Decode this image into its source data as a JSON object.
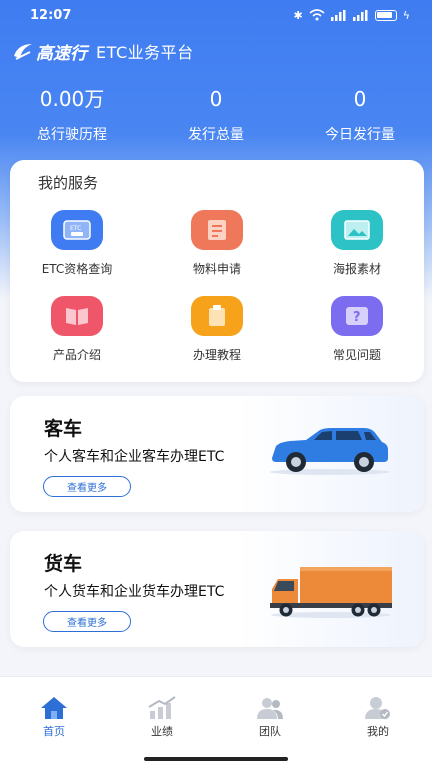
{
  "status_bar": {
    "time": "12:07"
  },
  "header": {
    "logo_text": "高速行",
    "title": "ETC业务平台"
  },
  "stats": [
    {
      "value": "0.00万",
      "label": "总行驶历程"
    },
    {
      "value": "0",
      "label": "发行总量"
    },
    {
      "value": "0",
      "label": "今日发行量"
    }
  ],
  "services": {
    "title": "我的服务",
    "items": [
      {
        "label": "ETC资格查询",
        "icon": "etc-card-icon",
        "color": "#3f7cf1"
      },
      {
        "label": "物料申请",
        "icon": "document-icon",
        "color": "#f0785a"
      },
      {
        "label": "海报素材",
        "icon": "image-icon",
        "color": "#2dc2c6"
      },
      {
        "label": "产品介绍",
        "icon": "book-icon",
        "color": "#f0566a"
      },
      {
        "label": "办理教程",
        "icon": "clipboard-icon",
        "color": "#f6a21a"
      },
      {
        "label": "常见问题",
        "icon": "question-icon",
        "color": "#7b6cf0"
      }
    ]
  },
  "passenger": {
    "title": "客车",
    "subtitle": "个人客车和企业客车办理ETC",
    "button": "查看更多"
  },
  "truck": {
    "title": "货车",
    "subtitle": "个人货车和企业货车办理ETC",
    "button": "查看更多"
  },
  "tabs": [
    {
      "label": "首页",
      "icon": "home-icon"
    },
    {
      "label": "业绩",
      "icon": "chart-icon"
    },
    {
      "label": "团队",
      "icon": "team-icon"
    },
    {
      "label": "我的",
      "icon": "profile-icon"
    }
  ],
  "colors": {
    "primary": "#3f7cf1",
    "accent_blue": "#2e6fd6",
    "tab_inactive": "#c8ccd4"
  }
}
